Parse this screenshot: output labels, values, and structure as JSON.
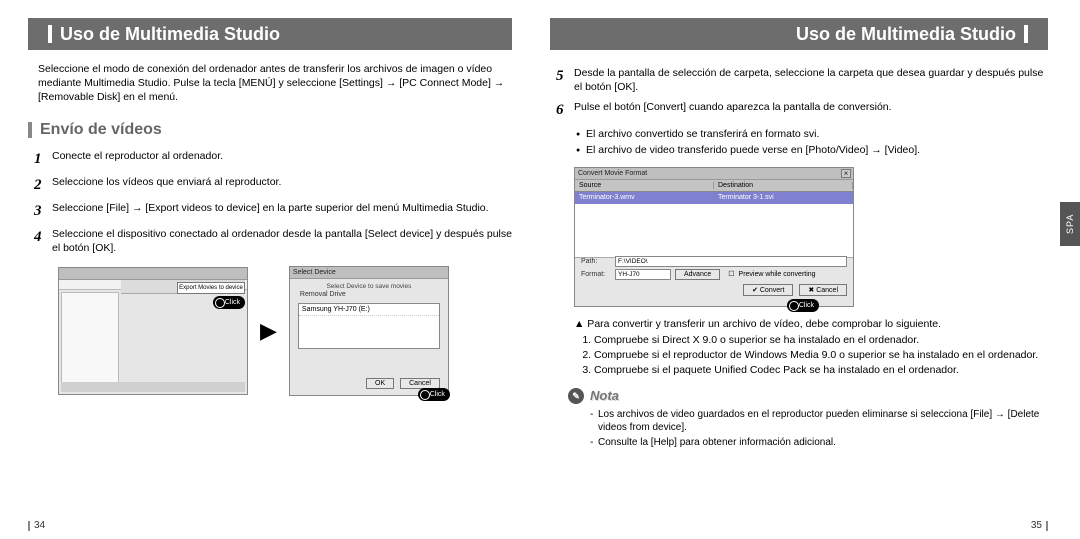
{
  "titles": {
    "left": "Uso de Multimedia Studio",
    "right": "Uso de Multimedia Studio"
  },
  "sidetab": "SPA",
  "intro": "Seleccione el modo de conexión del ordenador antes de transferir los archivos de imagen o vídeo mediante Multimedia Studio. Pulse la tecla [MENÚ] y seleccione [Settings] → [PC Connect Mode] → [Removable Disk] en el menú.",
  "section": "Envío de vídeos",
  "steps": {
    "s1n": "1",
    "s1": "Conecte el reproductor al ordenador.",
    "s2n": "2",
    "s2": "Seleccione los vídeos que enviará al reproductor.",
    "s3n": "3",
    "s3": "Seleccione [File] → [Export videos to device] en la parte superior del menú Multimedia Studio.",
    "s4n": "4",
    "s4": "Seleccione el dispositivo conectado al ordenador desde la pantalla [Select device] y después pulse el botón [OK].",
    "s5n": "5",
    "s5": "Desde la pantalla de selección de carpeta, seleccione la carpeta que desea guardar y después pulse el botón [OK].",
    "s6n": "6",
    "s6": "Pulse el botón [Convert] cuando aparezca la pantalla de conversión."
  },
  "bullets": {
    "b1": "El archivo convertido se transferirá en formato svi.",
    "b2": "El archivo de video transferido puede verse en [Photo/Video] → [Video]."
  },
  "fig1": {
    "export_btn": "Export Movies to device",
    "click": "Click"
  },
  "fig2": {
    "titlebar": "Select Device",
    "caption": "Select Device to save movies",
    "label": "Removal Drive",
    "item": "Samsung YH-J70 (E:)",
    "ok": "OK",
    "cancel": "Cancel",
    "click": "Click"
  },
  "fig3": {
    "titlebar": "Convert Movie Format",
    "col1": "Source",
    "col2": "Destination",
    "row1a": "Terminator-3.wmv",
    "row1b": "Terminator 3-1.svi",
    "path_lbl": "Path:",
    "path_val": "F:\\VIDEO\\",
    "fmt_lbl": "Format:",
    "fmt_val": "YH-J70",
    "adv": "Advance",
    "chk": "Preview while converting",
    "convert": "Convert",
    "cancel": "Cancel",
    "click": "Click"
  },
  "note": {
    "lead": "▲ Para convertir y transferir un archivo de vídeo, debe comprobar lo siguiente.",
    "n1": "Compruebe si Direct X 9.0 o superior se ha instalado en el ordenador.",
    "n2": "Compruebe si el reproductor de Windows Media 9.0 o superior se ha instalado en el ordenador.",
    "n3": "Compruebe si el paquete Unified Codec Pack se ha instalado en el ordenador."
  },
  "nota": {
    "label": "Nota",
    "l1": "Los archivos de video guardados en el reproductor pueden eliminarse si selecciona [File] → [Delete videos from device].",
    "l2": "Consulte la [Help] para obtener información adicional."
  },
  "pagenums": {
    "left": "34",
    "right": "35"
  }
}
